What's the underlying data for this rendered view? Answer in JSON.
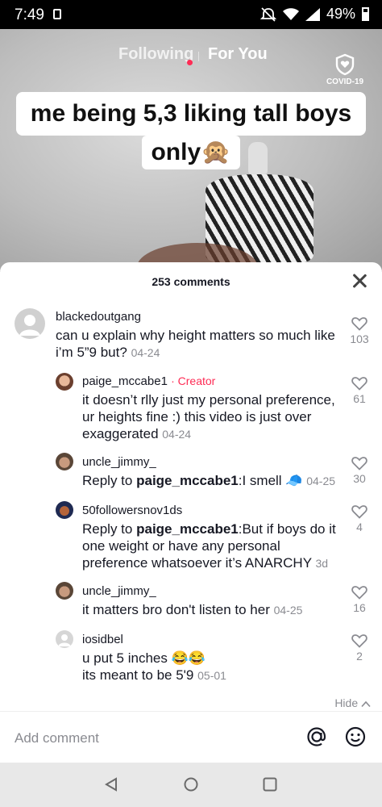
{
  "status_bar": {
    "time": "7:49",
    "battery": "49%"
  },
  "top_nav": {
    "following": "Following",
    "for_you": "For You",
    "covid_label": "COVID-19"
  },
  "video": {
    "caption_line1": "me being 5,3 liking tall boys",
    "caption_line2": "only🙊"
  },
  "comments_sheet": {
    "count_label": "253 comments",
    "comments": [
      {
        "username": "blackedoutgang",
        "text": "can u explain why height matters so much like i’m 5”9 but?",
        "date": "04-24",
        "likes": "103",
        "avatar": "default-avatar"
      },
      {
        "username": "paige_mccabe1",
        "creator_tag": "· Creator",
        "text": "it doesn’t rlly just my personal preference, ur heights fine :) this video is just over exaggerated",
        "date": "04-24",
        "likes": "61"
      },
      {
        "username": "uncle_jimmy_",
        "reply_prefix": "Reply to",
        "reply_to": "paige_mccabe1",
        "text": ":I smell 🧢",
        "date": "04-25",
        "likes": "30"
      },
      {
        "username": "50followersnov1ds",
        "reply_prefix": "Reply to",
        "reply_to": "paige_mccabe1",
        "text": ":But if boys do it one weight or have any personal preference whatsoever it’s ANARCHY",
        "date": "3d",
        "likes": "4"
      },
      {
        "username": "uncle_jimmy_",
        "text": "it matters bro don't listen to her",
        "date": "04-25",
        "likes": "16"
      },
      {
        "username": "iosidbel",
        "text_line1": "u put 5 inches 😂😂",
        "text_line2": "its meant to be 5'9",
        "date": "05-01",
        "likes": "2"
      }
    ],
    "hide_label": "Hide",
    "add_comment_placeholder": "Add comment"
  }
}
